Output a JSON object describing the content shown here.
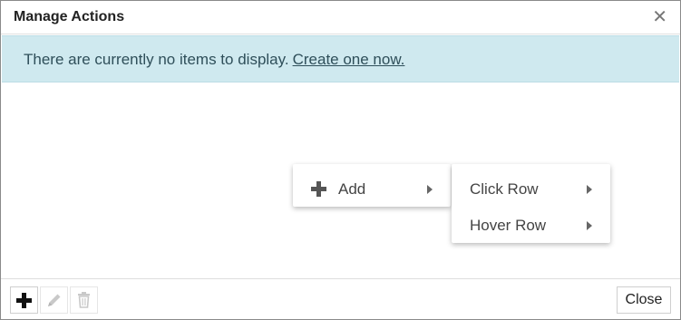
{
  "dialog": {
    "title": "Manage Actions",
    "close_icon": "close-icon"
  },
  "notice": {
    "text": "There are currently no items to display.",
    "link": "Create one now."
  },
  "context_menu": {
    "items": [
      {
        "label": "Add",
        "icon": "plus-icon",
        "has_submenu": true
      }
    ],
    "submenu": [
      {
        "label": "Click Row",
        "has_submenu": true
      },
      {
        "label": "Hover Row",
        "has_submenu": true
      }
    ]
  },
  "footer": {
    "tools": [
      {
        "name": "add",
        "icon": "plus-icon",
        "enabled": true
      },
      {
        "name": "edit",
        "icon": "pencil-icon",
        "enabled": false
      },
      {
        "name": "delete",
        "icon": "trash-icon",
        "enabled": false
      }
    ],
    "close_label": "Close"
  },
  "colors": {
    "notice_bg": "#cfe9ef",
    "notice_text": "#2f4f5a"
  }
}
